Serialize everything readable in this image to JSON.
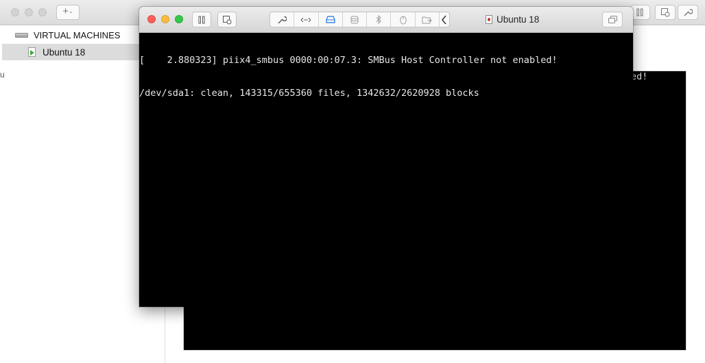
{
  "library": {
    "section_label": "VIRTUAL MACHINES",
    "vm_item_label": "Ubuntu 18",
    "add_button": "+",
    "add_chevron": "⌄",
    "edge_char": "u",
    "back_screen_partial_text": "ed!"
  },
  "vm_window": {
    "title": "Ubuntu 18",
    "toolbar_icons": [
      "pause-icon",
      "snapshot-icon",
      "wrench-icon",
      "network-icon",
      "hard-disk-icon",
      "storage-icon",
      "bluetooth-icon",
      "mouse-icon",
      "shared-folder-icon",
      "chevron-left-icon",
      "fullscreen-icon"
    ],
    "console_lines": [
      "[    2.880323] piix4_smbus 0000:00:07.3: SMBus Host Controller not enabled!",
      "/dev/sda1: clean, 143315/655360 files, 1342632/2620928 blocks"
    ]
  },
  "colors": {
    "close": "#fc605b",
    "minimize": "#fdbc40",
    "maximize": "#34c84a",
    "console_bg": "#000000",
    "console_text": "#e8e8e8",
    "selection_bg": "#dcdcdc",
    "active_icon_blue": "#1a73e8"
  }
}
